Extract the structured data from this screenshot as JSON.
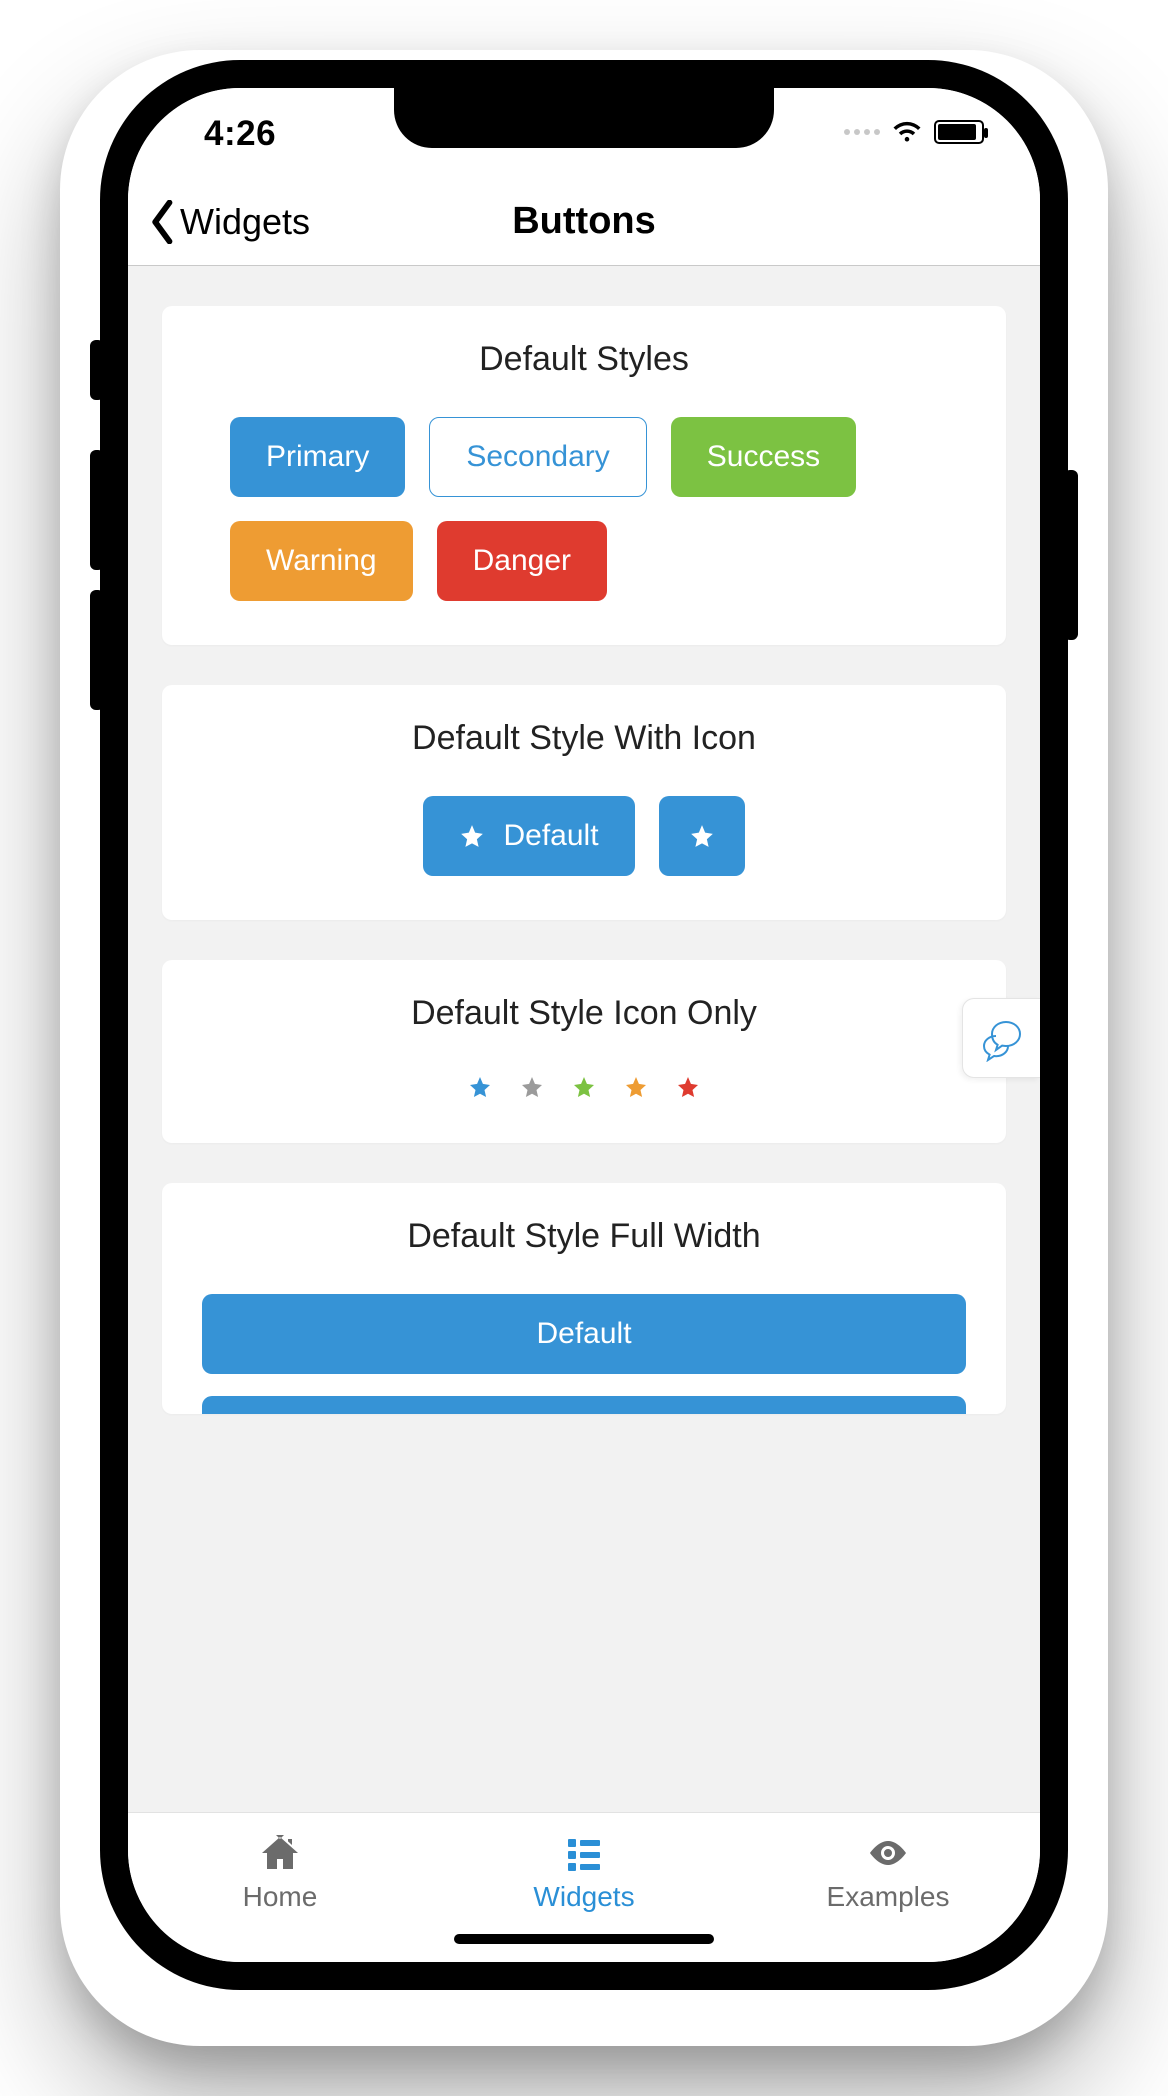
{
  "status": {
    "time": "4:26"
  },
  "nav": {
    "back_label": "Widgets",
    "title": "Buttons"
  },
  "card1": {
    "title": "Default Styles",
    "buttons": {
      "primary": "Primary",
      "secondary": "Secondary",
      "success": "Success",
      "warning": "Warning",
      "danger": "Danger"
    }
  },
  "card2": {
    "title": "Default Style With Icon",
    "btn_label": "Default"
  },
  "card3": {
    "title": "Default Style Icon Only",
    "stars": [
      {
        "name": "star-primary",
        "color": "#3693d6"
      },
      {
        "name": "star-secondary",
        "color": "#9b9b9b"
      },
      {
        "name": "star-success",
        "color": "#7cc242"
      },
      {
        "name": "star-warning",
        "color": "#ee9c33"
      },
      {
        "name": "star-danger",
        "color": "#df3b2f"
      }
    ]
  },
  "card4": {
    "title": "Default Style Full Width",
    "btn_label": "Default"
  },
  "tabs": {
    "home": "Home",
    "widgets": "Widgets",
    "examples": "Examples"
  }
}
